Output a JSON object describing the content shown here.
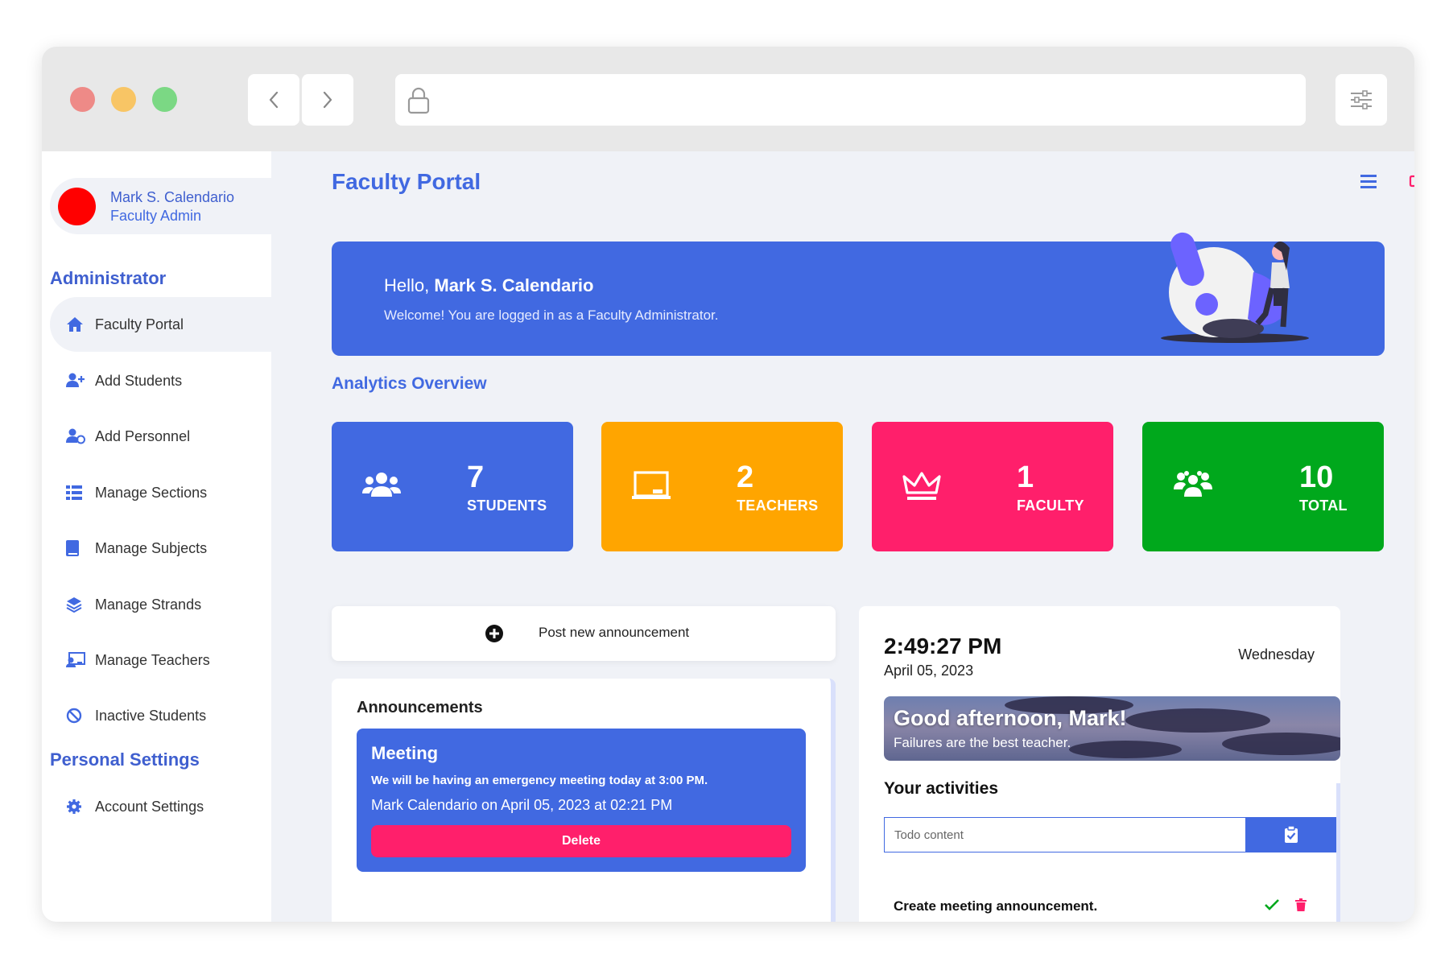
{
  "browser": {
    "back_icon": "chevron-left-icon",
    "forward_icon": "chevron-right-icon",
    "lock_icon": "lock-icon",
    "settings_icon": "sliders-icon"
  },
  "sidebar": {
    "profile": {
      "name": "Mark S. Calendario",
      "role": "Faculty Admin",
      "avatar_color": "#ff0000"
    },
    "section_admin": "Administrator",
    "items": [
      {
        "label": "Faculty Portal",
        "icon": "home-icon",
        "active": true
      },
      {
        "label": "Add Students",
        "icon": "user-plus-icon"
      },
      {
        "label": "Add Personnel",
        "icon": "user-clock-icon"
      },
      {
        "label": "Manage Sections",
        "icon": "list-icon"
      },
      {
        "label": "Manage Subjects",
        "icon": "book-icon"
      },
      {
        "label": "Manage Strands",
        "icon": "layers-icon"
      },
      {
        "label": "Manage Teachers",
        "icon": "chalkboard-teacher-icon"
      },
      {
        "label": "Inactive Students",
        "icon": "ban-icon"
      }
    ],
    "section_personal": "Personal Settings",
    "personal_items": [
      {
        "label": "Account Settings",
        "icon": "gear-icon"
      }
    ]
  },
  "header": {
    "title": "Faculty Portal",
    "menu_icon": "hamburger-icon",
    "logout_icon": "sign-out-icon"
  },
  "banner": {
    "hello": "Hello,",
    "name": "Mark S. Calendario",
    "welcome": "Welcome! You are logged in as a Faculty Administrator."
  },
  "analytics": {
    "title": "Analytics Overview",
    "cards": [
      {
        "value": "7",
        "label": "STUDENTS",
        "icon": "users-icon",
        "color": "#4169e1"
      },
      {
        "value": "2",
        "label": "TEACHERS",
        "icon": "chalkboard-icon",
        "color": "#ffa500"
      },
      {
        "value": "1",
        "label": "FACULTY",
        "icon": "crown-icon",
        "color": "#ff1f6b"
      },
      {
        "value": "10",
        "label": "TOTAL",
        "icon": "group-icon",
        "color": "#00a81c"
      }
    ]
  },
  "post": {
    "label": "Post new announcement",
    "icon": "plus-circle-icon"
  },
  "announcements": {
    "title": "Announcements",
    "items": [
      {
        "heading": "Meeting",
        "body": "We will be having an emergency meeting today at 3:00 PM.",
        "meta": "Mark Calendario on April 05, 2023 at 02:21 PM",
        "delete_label": "Delete"
      }
    ]
  },
  "clock": {
    "time": "2:49:27 PM",
    "date": "April 05, 2023",
    "day": "Wednesday",
    "greeting": "Good afternoon, Mark!",
    "quote": "Failures are the best teacher."
  },
  "activities": {
    "title": "Your activities",
    "input_placeholder": "Todo content",
    "add_icon": "clipboard-check-icon",
    "items": [
      {
        "text": "Create meeting announcement.",
        "check_icon": "check-icon",
        "delete_icon": "trash-icon"
      }
    ]
  },
  "colors": {
    "primary": "#4169e1",
    "orange": "#ffa500",
    "pink": "#ff1f6b",
    "green": "#00a81c"
  }
}
